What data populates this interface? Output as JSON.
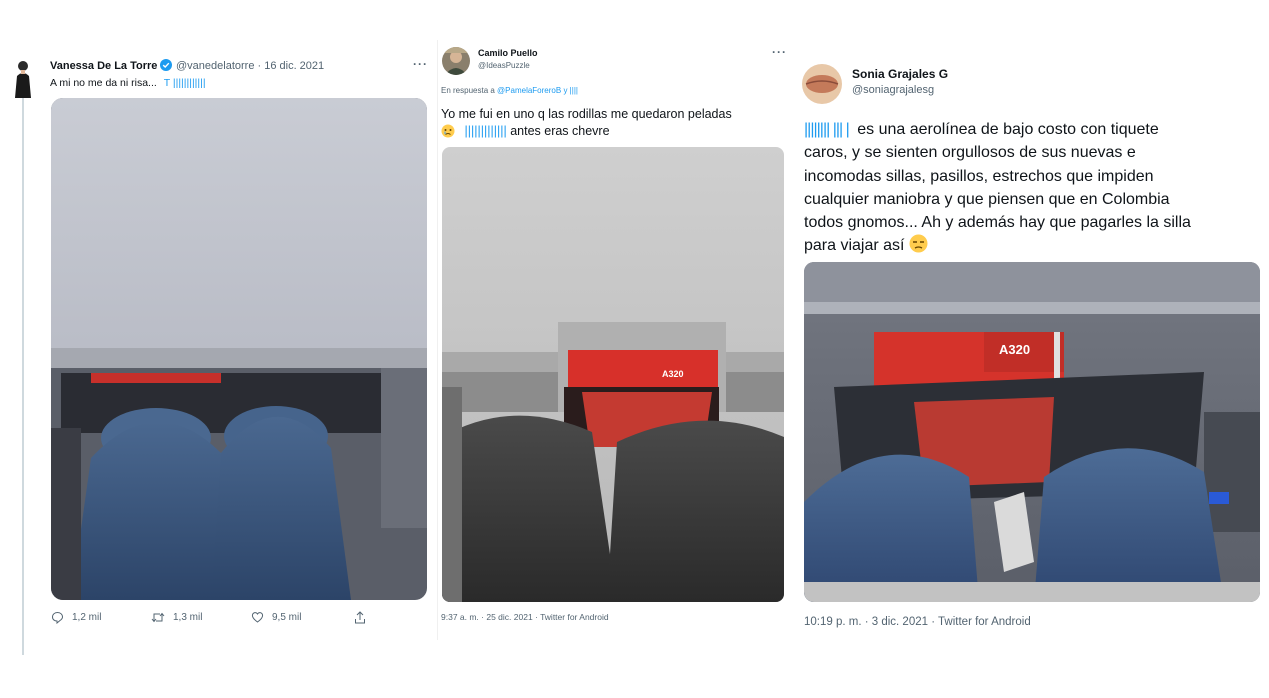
{
  "tweet1": {
    "name": "Vanessa De La Torre",
    "handle": "@vanedelatorre",
    "date": "· 16 dic. 2021",
    "more": "···",
    "text": "A mi no me da ni risa...",
    "tags": "T ||||||||||||",
    "actions": {
      "reply": "1,2 mil",
      "retweet": "1,3 mil",
      "like": "9,5 mil"
    }
  },
  "tweet2": {
    "name": "Camilo Puello",
    "handle": "@IdeasPuzzle",
    "more": "···",
    "reply_prefix": "En respuesta a",
    "reply_to": "@PamelaForeroB",
    "reply_suffix": "y ||||",
    "line1": "Yo me fui en uno q las rodillas me quedaron peladas",
    "tags": "|||||||||||||",
    "line2_rest": "antes eras chevre",
    "timestamp": "9:37 a. m. · 25 dic. 2021 · Twitter for Android"
  },
  "tweet3": {
    "name": "Sonia Grajales G",
    "handle": "@soniagrajalesg",
    "tags": "|||||||| |||  |",
    "line1_rest": "es una aerolínea de bajo costo con tiquete",
    "lines": [
      "caros, y se sienten orgullosos de sus nuevas e",
      "incomodas sillas, pasillos, estrechos que impiden",
      "cualquier maniobra y que piensen que en Colombia",
      "todos gnomos... Ah y además hay que pagarles la silla"
    ],
    "last_line": "para viajar así",
    "timestamp": "10:19 p. m. · 3 dic. 2021 · Twitter for Android",
    "photo_label": "A320"
  },
  "colors": {
    "link": "#1d9bf0",
    "muted": "#536471",
    "verified": "#1d9bf0",
    "denim": "#3d5a80",
    "seat_red": "#d63a2f"
  }
}
